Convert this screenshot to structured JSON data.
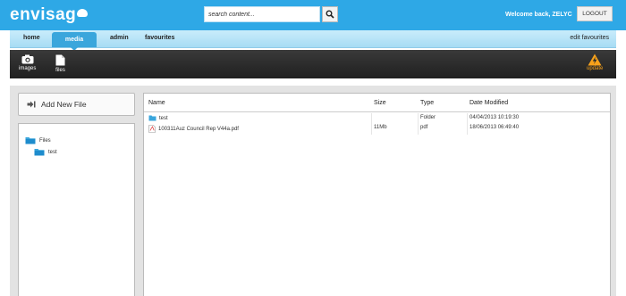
{
  "app": {
    "logo": "envisag"
  },
  "search": {
    "placeholder": "search content..."
  },
  "header": {
    "welcome": "Welcome back, ZELYC",
    "logout_label": "LOGOUT"
  },
  "nav": {
    "items": [
      {
        "label": "home"
      },
      {
        "label": "media",
        "active": true
      },
      {
        "label": "admin"
      },
      {
        "label": "favourites"
      }
    ],
    "edit_favourites": "edit favourites"
  },
  "toolbar": {
    "images_label": "images",
    "files_label": "files",
    "update_label": "update"
  },
  "sidebar": {
    "add_new_file": "Add New File",
    "tree": [
      {
        "label": "Files",
        "level": 0
      },
      {
        "label": "test",
        "level": 1
      }
    ]
  },
  "files_table": {
    "columns": [
      "Name",
      "Size",
      "Type",
      "Date Modified"
    ],
    "rows": [
      {
        "icon": "folder-icon",
        "name": "test",
        "size": "",
        "type": "Folder",
        "date": "04/04/2013 10:19:30"
      },
      {
        "icon": "pdf-icon",
        "name": "100311Auz Council Rep V44a.pdf",
        "size": "11Mb",
        "type": "pdf",
        "date": "18/06/2013 06:49:40"
      }
    ]
  },
  "colors": {
    "brand_blue": "#2ea8e6",
    "nav_light": "#c9ecfb",
    "toolbar_dark": "#2a2a2a",
    "update_orange": "#f7a21b"
  }
}
